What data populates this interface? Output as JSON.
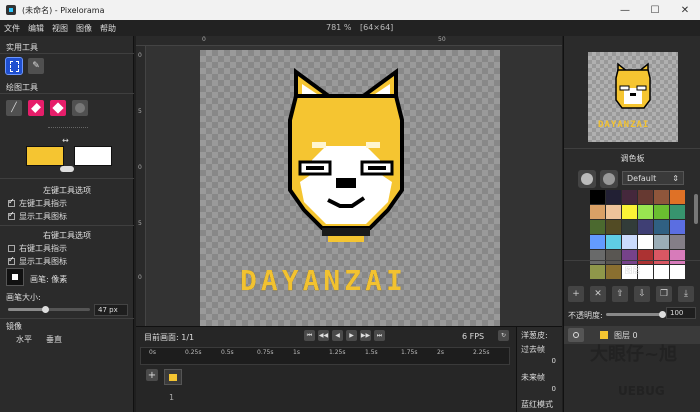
{
  "window": {
    "title": "(未命名) - Pixelorama",
    "minimize": "—",
    "maximize": "☐",
    "close": "✕"
  },
  "menu": {
    "items": [
      "文件",
      "编辑",
      "视图",
      "图像",
      "帮助"
    ],
    "zoom": "781 %",
    "canvas_size": "[64×64]"
  },
  "left_panel": {
    "utility_tools_title": "实用工具",
    "draw_tools_title": "绘图工具",
    "left_color": "#f5c531",
    "right_color": "#ffffff",
    "left_tool_options_title": "左键工具选项",
    "left_checks": [
      "左键工具指示",
      "显示工具图标"
    ],
    "right_tool_options_title": "右键工具选项",
    "right_checks": [
      "右键工具指示",
      "显示工具图标"
    ],
    "brush_label": "画笔: 像素",
    "brush_size_label": "画笔大小:",
    "brush_size_value": "47 px",
    "brush_size_fraction": 0.45,
    "mirror_title": "镜像",
    "mirror_horizontal": "水平",
    "mirror_vertical": "垂直"
  },
  "rulers": {
    "top_ticks": [
      "0",
      "50"
    ],
    "left_ticks": [
      "0",
      "5",
      "0",
      "5",
      "0"
    ]
  },
  "canvas": {
    "art_text": "DAYANZAI"
  },
  "timeline": {
    "current_frame": "目前画面: 1/1",
    "fps": "6 FPS",
    "ticks": [
      "0s",
      "0.25s",
      "0.5s",
      "0.75s",
      "1s",
      "1.25s",
      "1.5s",
      "1.75s",
      "2s",
      "2.25s"
    ],
    "add_button": "+",
    "frame_number": "1",
    "onion_title": "洋葱皮:",
    "past_frames": "过去帧",
    "past_value": "0",
    "future_frames": "未来帧",
    "future_value": "0",
    "blue_red_mode": "蓝红模式"
  },
  "right_panel": {
    "preview_text": "DAYANZAI",
    "palette_title": "调色板",
    "palette_name": "Default",
    "palette_colors": [
      "#000000",
      "#222034",
      "#45283c",
      "#663931",
      "#8f563b",
      "#df7126",
      "#d9a066",
      "#eec39a",
      "#fbf236",
      "#99e550",
      "#6abe30",
      "#37946e",
      "#4b692f",
      "#524b24",
      "#323c39",
      "#3f3f74",
      "#306082",
      "#5b6ee1",
      "#639bff",
      "#5fcde4",
      "#cbdbfc",
      "#ffffff",
      "#9badb7",
      "#847e87",
      "#696a6a",
      "#595652",
      "#76428a",
      "#ac3232",
      "#d95763",
      "#d77bba",
      "#8f974a",
      "#8a6f30",
      "#ffffff",
      "#ffffff",
      "#ffffff",
      "#ffffff"
    ],
    "layers_title": "图层",
    "opacity_label": "不透明度:",
    "opacity_value": "100",
    "layer_name": "图层 0"
  },
  "watermark": {
    "text": "大眼仔~旭",
    "sub": "UEBUG"
  }
}
